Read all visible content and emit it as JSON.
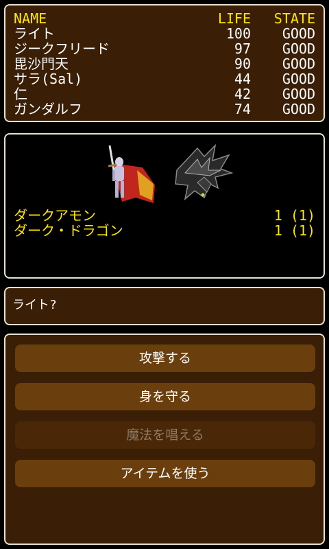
{
  "party": {
    "headers": {
      "name": "NAME",
      "life": "LIFE",
      "state": "STATE"
    },
    "members": [
      {
        "name": "ライト",
        "life": "100",
        "state": "GOOD"
      },
      {
        "name": "ジークフリード",
        "life": "97",
        "state": "GOOD"
      },
      {
        "name": "毘沙門天",
        "life": "90",
        "state": "GOOD"
      },
      {
        "name": "サラ(Sal)",
        "life": "44",
        "state": "GOOD"
      },
      {
        "name": "仁",
        "life": "42",
        "state": "GOOD"
      },
      {
        "name": "ガンダルフ",
        "life": "74",
        "state": "GOOD"
      }
    ]
  },
  "battle": {
    "enemies": [
      {
        "name": "ダークアモン",
        "count": "1 (1)"
      },
      {
        "name": "ダーク・ドラゴン",
        "count": "1 (1)"
      }
    ]
  },
  "prompt": {
    "text": "ライト?"
  },
  "menu": {
    "attack": "攻撃する",
    "defend": "身を守る",
    "cast_magic": "魔法を唱える",
    "use_item": "アイテムを使う"
  },
  "colors": {
    "highlight": "#ffe600",
    "panel_bg": "#3a1e06",
    "button_bg": "#6b3e0e"
  }
}
